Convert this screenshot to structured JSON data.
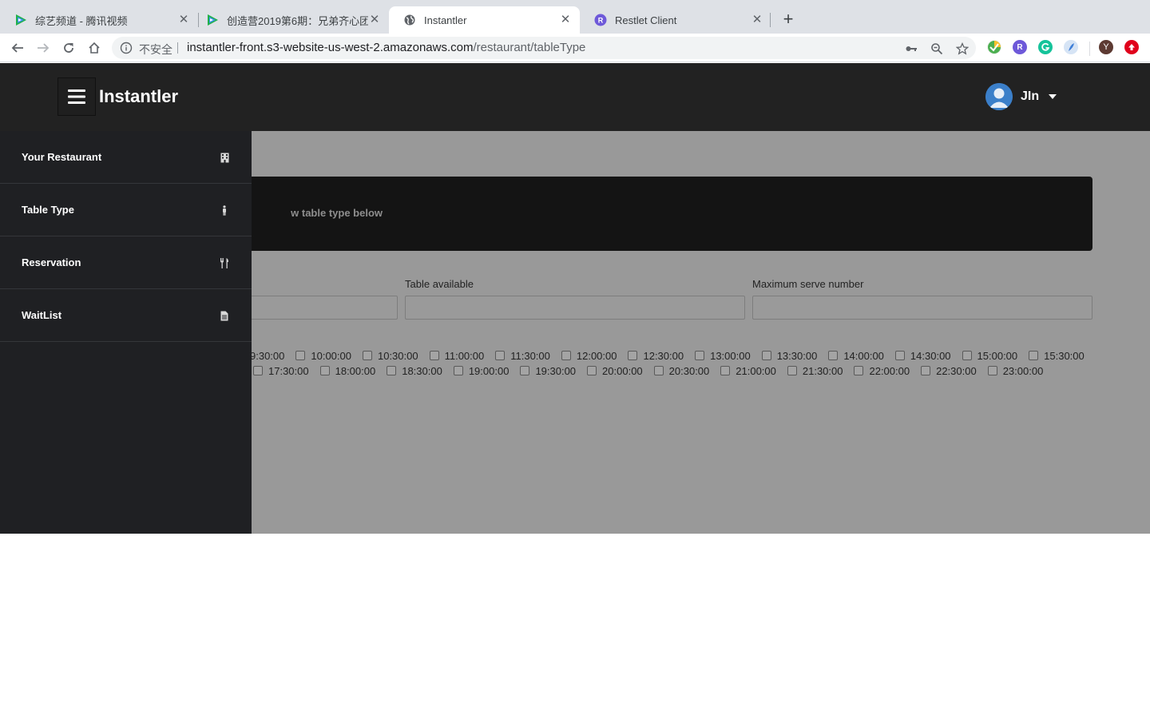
{
  "browser": {
    "tabs": [
      {
        "title": "综艺频道 - 腾讯视频",
        "favicon": "tencent-video-icon"
      },
      {
        "title": "创造营2019第6期：兄弟齐心团",
        "favicon": "tencent-video-icon"
      },
      {
        "title": "Instantler",
        "favicon": "globe-icon"
      },
      {
        "title": "Restlet Client",
        "favicon": "restlet-icon"
      }
    ],
    "address": {
      "security": "不安全",
      "host": "instantler-front.s3-website-us-west-2.amazonaws.com",
      "path": "/restaurant/tableType"
    },
    "profile_initial": "Y",
    "extension_restlet_label": "R"
  },
  "app": {
    "brand": "Instantler",
    "user_name": "JIn",
    "sidebar": [
      {
        "label": "Your Restaurant",
        "icon": "building-icon"
      },
      {
        "label": "Table Type",
        "icon": "person-icon"
      },
      {
        "label": "Reservation",
        "icon": "utensils-icon"
      },
      {
        "label": "WaitList",
        "icon": "file-icon"
      }
    ],
    "banner_text": "w table type below",
    "fields": {
      "table_available_label": "Table available",
      "max_serve_label": "Maximum serve number"
    },
    "time_slots_row1": [
      "9:30:00",
      "10:00:00",
      "10:30:00",
      "11:00:00",
      "11:30:00",
      "12:00:00",
      "12:30:00",
      "13:00:00",
      "13:30:00",
      "14:00:00",
      "14:30:00",
      "15:00:00",
      "15:30:00"
    ],
    "time_slots_row2": [
      "17:30:00",
      "18:00:00",
      "18:30:00",
      "19:00:00",
      "19:30:00",
      "20:00:00",
      "20:30:00",
      "21:00:00",
      "21:30:00",
      "22:00:00",
      "22:30:00",
      "23:00:00"
    ]
  },
  "colors": {
    "header_bg": "#222222",
    "sidebar_bg": "#1f2023",
    "overlay_bg": "#999999",
    "banner_bg": "#141414"
  }
}
